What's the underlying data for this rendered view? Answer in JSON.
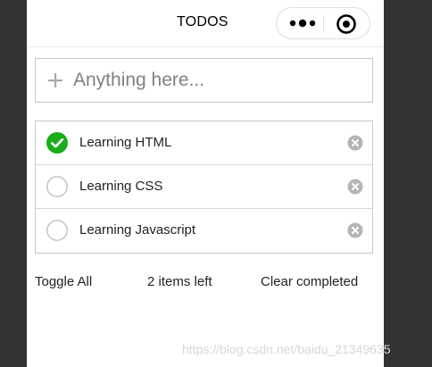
{
  "nav": {
    "title": "TODOS",
    "menu_icon": "more-dots-icon",
    "close_icon": "target-close-icon"
  },
  "input": {
    "placeholder": "Anything here...",
    "value": "",
    "icon": "plus-icon"
  },
  "todos": [
    {
      "label": "Learning HTML",
      "completed": true
    },
    {
      "label": "Learning CSS",
      "completed": false
    },
    {
      "label": "Learning Javascript",
      "completed": false
    }
  ],
  "footer": {
    "toggle_all": "Toggle All",
    "items_left": "2 items left",
    "clear_completed": "Clear completed"
  },
  "watermark": "https://blog.csdn.net/baidu_21349635",
  "colors": {
    "checked": "#1aad19",
    "unchecked_border": "#c0c0c0",
    "remove_icon": "#b5b5b5",
    "side_panels": "#333333"
  }
}
